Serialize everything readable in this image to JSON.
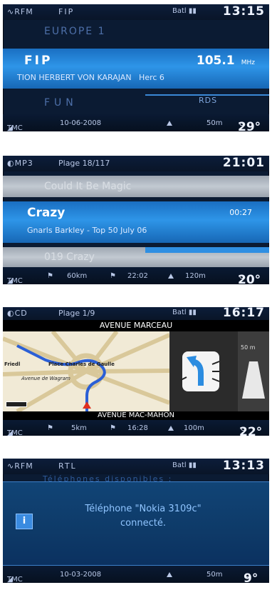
{
  "screen1": {
    "source": "RFM",
    "station_header": "FIP",
    "signal": "Batl",
    "clock": "13:15",
    "prev_station": "EUROPE 1",
    "current_station": "FIP",
    "frequency": "105.1",
    "frequency_unit": "MHz",
    "radiotext": "TION HERBERT VON KARAJAN   Herc 6",
    "next_station": "FUN",
    "rds": "RDS",
    "footer": {
      "tmc": "TMC",
      "date": "10-06-2008",
      "distance": "50m",
      "temp": "29°",
      "temp_unit": "c"
    }
  },
  "screen2": {
    "source": "MP3",
    "track_header": "Plage 18/117",
    "clock": "21:01",
    "prev_track": "Could It Be Magic",
    "current_track": "Crazy",
    "elapsed": "00:27",
    "artist_album": "Gnarls Barkley - Top 50 July 06",
    "next_track": "019 Crazy",
    "footer": {
      "tmc": "TMC",
      "dist1": "60km",
      "eta": "22:02",
      "dist2": "120m",
      "temp": "20°",
      "temp_unit": "c"
    }
  },
  "screen3": {
    "source": "CD",
    "track_header": "Plage 1/9",
    "signal": "Batl",
    "clock": "16:17",
    "street_current": "AVENUE MARCEAU",
    "map_label_1": "Place Charles de Gaulle",
    "map_label_2": "Avenue de Wagram",
    "map_label_3": "Friedl",
    "street_next": "AVENUE MAC-MAHON",
    "lane_distance": "50 m",
    "footer": {
      "tmc": "TMC",
      "dist1": "5km",
      "eta": "16:28",
      "dist2": "100m",
      "temp": "22°",
      "temp_unit": "c"
    }
  },
  "screen4": {
    "source": "RFM",
    "station_header": "RTL",
    "signal": "Batl",
    "clock": "13:13",
    "background_text": "Téléphones disponibles :",
    "message_line1": "Téléphone \"Nokia 3109c\"",
    "message_line2": "connecté.",
    "info_icon_glyph": "i",
    "footer": {
      "tmc": "TMC",
      "date": "10-03-2008",
      "distance": "50m",
      "temp": "9°",
      "temp_unit": "c"
    }
  }
}
